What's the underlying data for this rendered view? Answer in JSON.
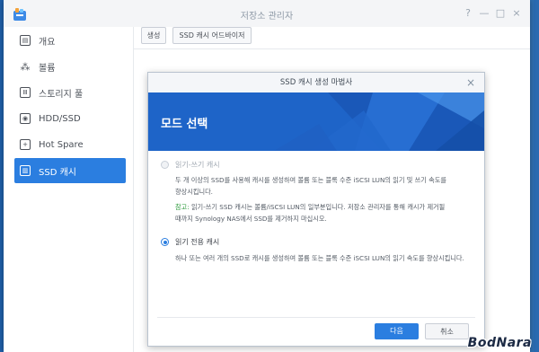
{
  "window": {
    "title": "저장소 관리자",
    "controls": {
      "help": "?",
      "minimize": "—",
      "maximize": "□",
      "close": "×"
    }
  },
  "sidebar": {
    "items": [
      {
        "label": "개요",
        "icon": "overview-icon",
        "active": false
      },
      {
        "label": "볼륨",
        "icon": "volume-icon",
        "active": false
      },
      {
        "label": "스토리지 풀",
        "icon": "storage-pool-icon",
        "active": false
      },
      {
        "label": "HDD/SSD",
        "icon": "hdd-icon",
        "active": false
      },
      {
        "label": "Hot Spare",
        "icon": "hot-spare-icon",
        "active": false
      },
      {
        "label": "SSD 캐시",
        "icon": "ssd-cache-icon",
        "active": true
      }
    ]
  },
  "toolbar": {
    "create_label": "생성",
    "advisor_label": "SSD 캐시 어드바이저"
  },
  "dialog": {
    "title": "SSD 캐시 생성 마법사",
    "close": "×",
    "banner_title": "모드 선택",
    "option1": {
      "label": "읽기-쓰기 캐시",
      "selected": false,
      "desc_line1": "두 개 이상의 SSD를 사용해 캐시를 생성하여 볼륨 또는 블록 수준 iSCSI LUN의 읽기 및 쓰기 속도를",
      "desc_line2": "향상시킵니다.",
      "note_prefix": "참고:",
      "note_line1": " 읽기-쓰기 SSD 캐시는 볼륨/iSCSI LUN의 일부분입니다. 저장소 관리자를 통해 캐시가 제거될",
      "note_line2": "때까지 Synology NAS에서 SSD를 제거하지 마십시오."
    },
    "option2": {
      "label": "읽기 전용 캐시",
      "selected": true,
      "desc_line1": "하나 또는 여러 개의 SSD로 캐시를 생성하여 볼륨 또는 블록 수준 iSCSI LUN의 읽기 속도를 향상시킵니다."
    },
    "next_label": "다음",
    "cancel_label": "취소"
  },
  "watermark": "BodNara",
  "colors": {
    "accent": "#2b7ee0",
    "banner": "#1e64c8",
    "note": "#2b9a3a"
  }
}
